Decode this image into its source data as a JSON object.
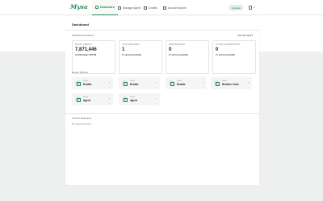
{
  "logo": "Mysa",
  "nav": [
    {
      "label": "Dashboard",
      "icon": "dashboard-icon",
      "active": true
    },
    {
      "label": "Manage Agent",
      "icon": "agent-icon",
      "active": false
    },
    {
      "label": "Credits",
      "icon": "credits-icon",
      "active": false
    },
    {
      "label": "Account Admin",
      "icon": "account-icon",
      "active": false
    }
  ],
  "header": {
    "upgrade_label": "Upgrade",
    "user_icon": "user-icon",
    "caret_icon": "chevron-down-icon"
  },
  "page_title": "Dashboard",
  "analytics": {
    "title": "Dashboard Analytics",
    "range": "Last 30 days",
    "cards": [
      {
        "label": "WALLET CREDITS",
        "value": "7,871,446",
        "change": "",
        "change_dir": "",
        "change_rest": "Last Recharge: 7871446"
      },
      {
        "label": "TOTAL MESSAGES",
        "value": "1",
        "change": "0%",
        "change_dir": "up",
        "change_rest": "up from yesterday"
      },
      {
        "label": "RESPONSE RATE",
        "value": "0",
        "change": "0%",
        "change_dir": "up",
        "change_rest": "up from yesterday"
      },
      {
        "label": "ACTIVE CONVERSATIONS",
        "value": "0",
        "change": "0%",
        "change_dir": "down",
        "change_rest": "up from yesterday"
      }
    ]
  },
  "devices": {
    "title": "Device Binders",
    "items": [
      {
        "label": "Binder",
        "name": "Enable"
      },
      {
        "label": "Binder",
        "name": "Enable"
      },
      {
        "label": "Binder",
        "name": "Enable"
      },
      {
        "label": "Binder",
        "name": "Newline Code"
      },
      {
        "label": "Binder",
        "name": "Agent"
      },
      {
        "label": "Binder",
        "name": "Agent"
      }
    ]
  },
  "recent": {
    "title": "Current Response",
    "empty": "No request received"
  }
}
